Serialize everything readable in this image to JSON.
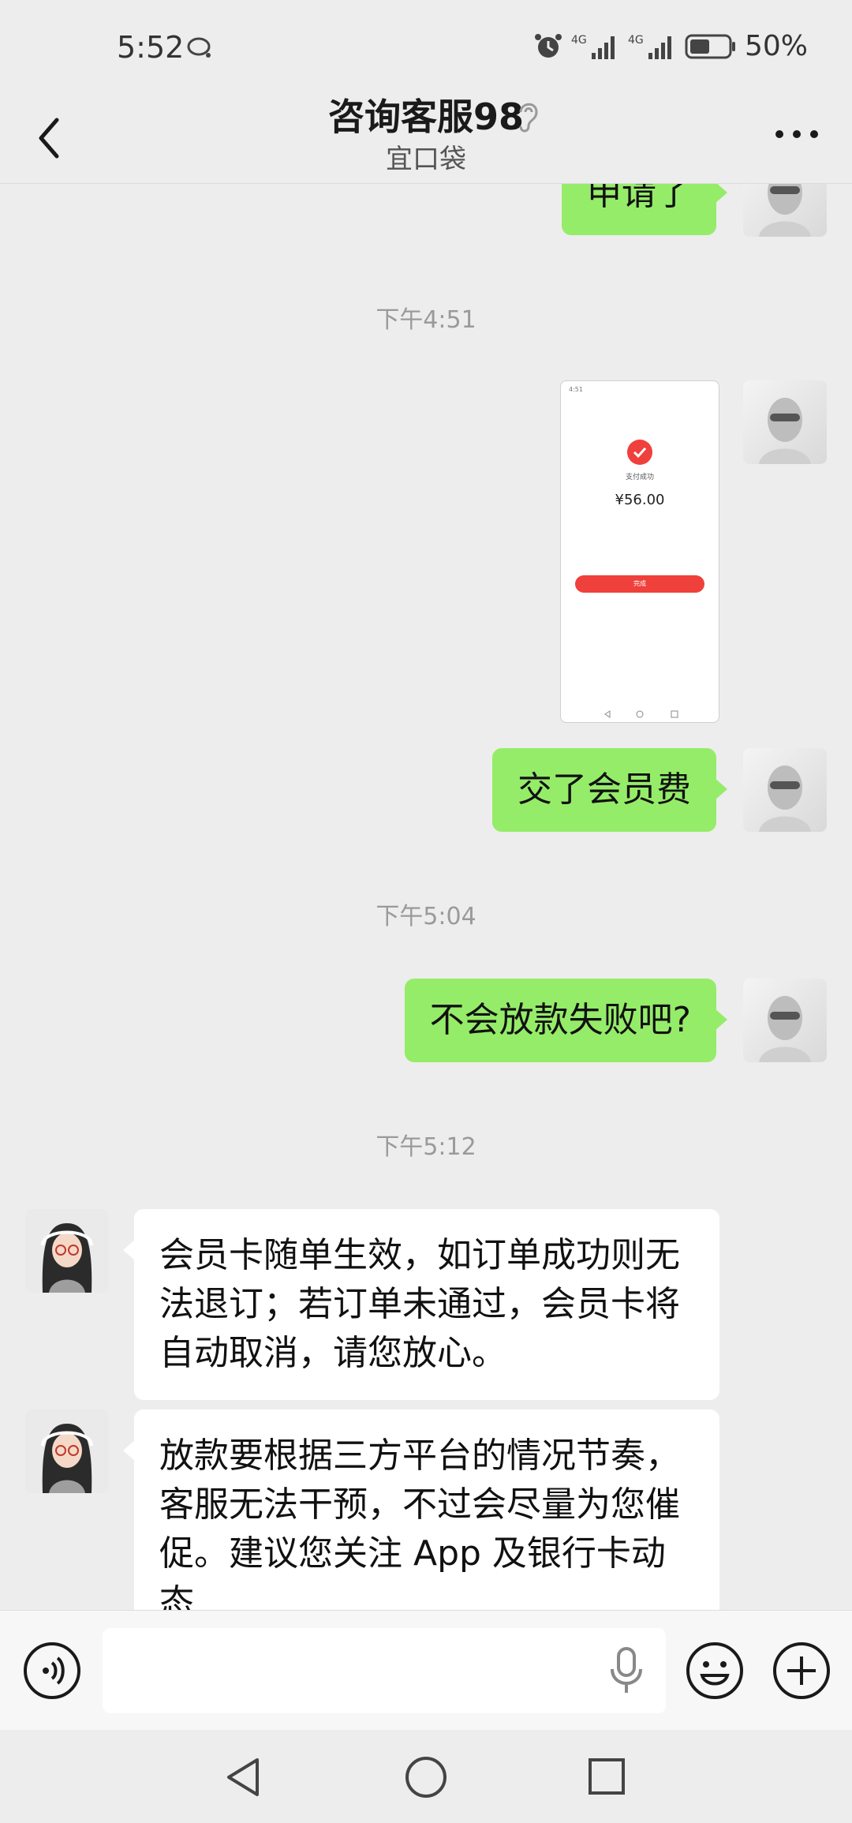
{
  "status_bar": {
    "time": "5:52",
    "battery_percent": "50%",
    "network_1": "4G",
    "network_2": "4G"
  },
  "header": {
    "title": "咨询客服98",
    "subtitle": "宜口袋"
  },
  "messages": {
    "m0": "申请了",
    "ts1": "下午4:51",
    "img_thumb": {
      "status": "4:51",
      "label": "支付成功",
      "amount": "¥56.00",
      "button": "完成"
    },
    "m2": "交了会员费",
    "ts2": "下午5:04",
    "m3": "不会放款失败吧?",
    "ts3": "下午5:12",
    "m4": "会员卡随单生效，如订单成功则无法退订；若订单未通过，会员卡将自动取消，请您放心。",
    "m5": "放款要根据三方平台的情况节奏，客服无法干预，不过会尽量为您催促。建议您关注 App 及银行卡动态"
  },
  "input": {
    "placeholder": ""
  },
  "colors": {
    "green_bubble": "#95ec69",
    "background": "#ededed",
    "white_bubble": "#ffffff"
  },
  "icons": [
    "back-arrow-icon",
    "ear-icon",
    "more-icon",
    "voice-icon",
    "mic-icon",
    "emoji-icon",
    "plus-icon",
    "nav-back-icon",
    "nav-home-icon",
    "nav-recent-icon"
  ]
}
